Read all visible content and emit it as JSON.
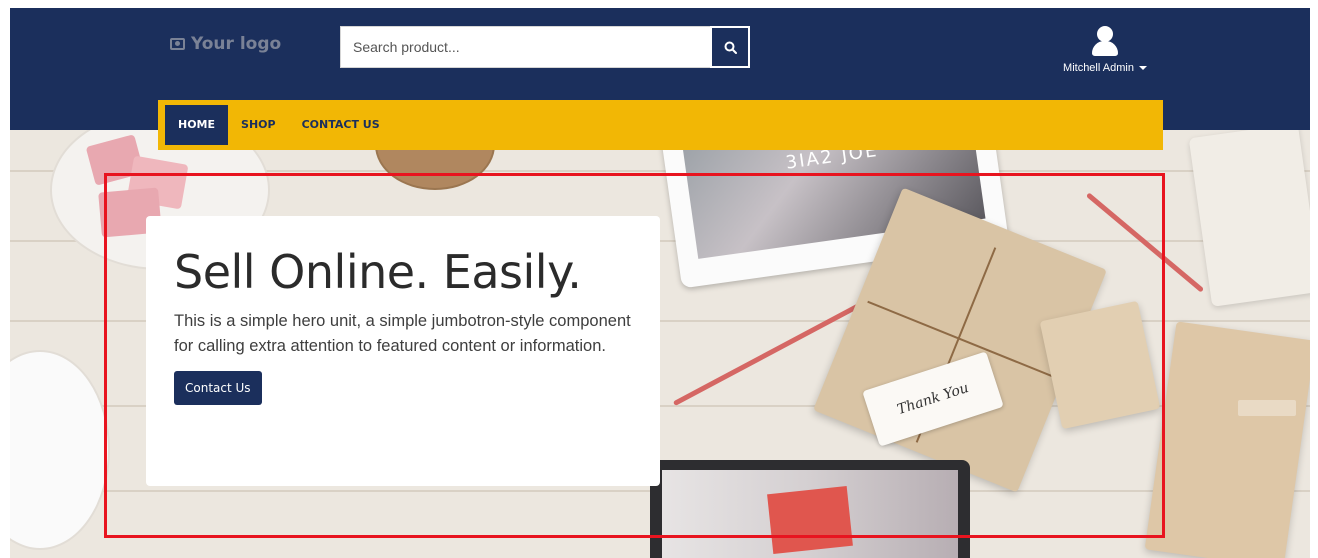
{
  "header": {
    "logo_text": "Your logo",
    "logo_icon": "camera-icon",
    "search": {
      "placeholder": "Search product...",
      "value": "",
      "button_icon": "search-icon"
    },
    "user": {
      "name": "Mitchell Admin",
      "avatar_icon": "user-icon",
      "caret_icon": "caret-down-icon"
    }
  },
  "nav": {
    "items": [
      {
        "label": "HOME",
        "active": true
      },
      {
        "label": "SHOP",
        "active": false
      },
      {
        "label": "CONTACT US",
        "active": false
      }
    ]
  },
  "hero": {
    "title": "Sell Online. Easily.",
    "body": "This is a simple hero unit, a simple jumbotron-style component for calling extra attention to featured content or information.",
    "button_label": "Contact Us"
  },
  "colors": {
    "header_bg": "#1b2f5c",
    "nav_bg": "#f2b705",
    "button_bg": "#1b2f5c",
    "highlight_border": "#e8141f"
  }
}
